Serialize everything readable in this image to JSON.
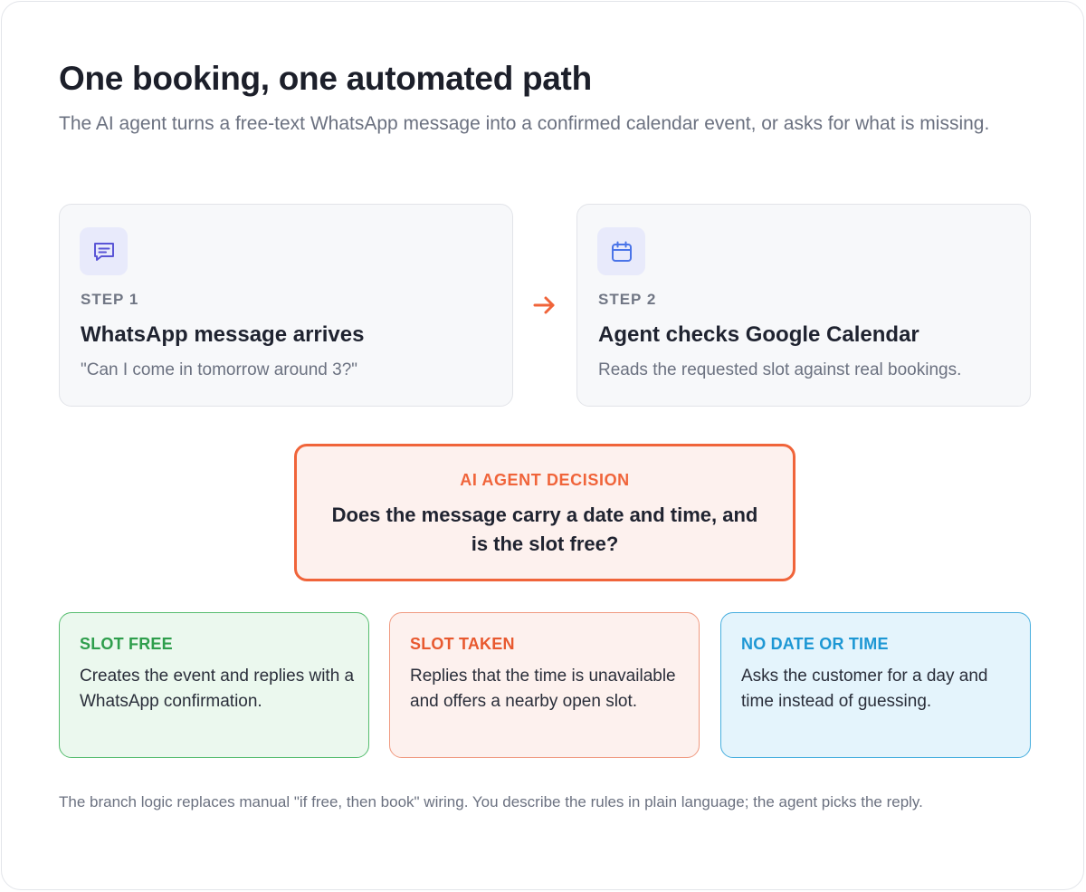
{
  "header": {
    "title": "One booking, one automated path",
    "subtitle": "The AI agent turns a free-text WhatsApp message into a confirmed calendar event, or asks for what is missing."
  },
  "steps": [
    {
      "icon": "message-icon",
      "label": "STEP 1",
      "title": "WhatsApp message arrives",
      "description": "\"Can I come in tomorrow around 3?\""
    },
    {
      "icon": "calendar-icon",
      "label": "STEP 2",
      "title": "Agent checks Google Calendar",
      "description": "Reads the requested slot against real bookings."
    }
  ],
  "decision": {
    "label": "AI AGENT DECISION",
    "question": "Does the message carry a date and time, and is the slot free?"
  },
  "branches": [
    {
      "label": "SLOT FREE",
      "text": "Creates the event and replies with a WhatsApp confirmation.",
      "color": "#2e9e4c"
    },
    {
      "label": "SLOT TAKEN",
      "text": "Replies that the time is unavailable and offers a nearby open slot.",
      "color": "#e8592f"
    },
    {
      "label": "NO DATE OR TIME",
      "text": "Asks the customer for a day and time instead of guessing.",
      "color": "#1d97d4"
    }
  ],
  "footnote": "The branch logic replaces manual \"if free, then book\" wiring. You describe the rules in plain language; the agent picks the reply.",
  "colors": {
    "accent": "#f0643a",
    "icon": "#5a55d6",
    "calendar_icon": "#4a74e8"
  }
}
